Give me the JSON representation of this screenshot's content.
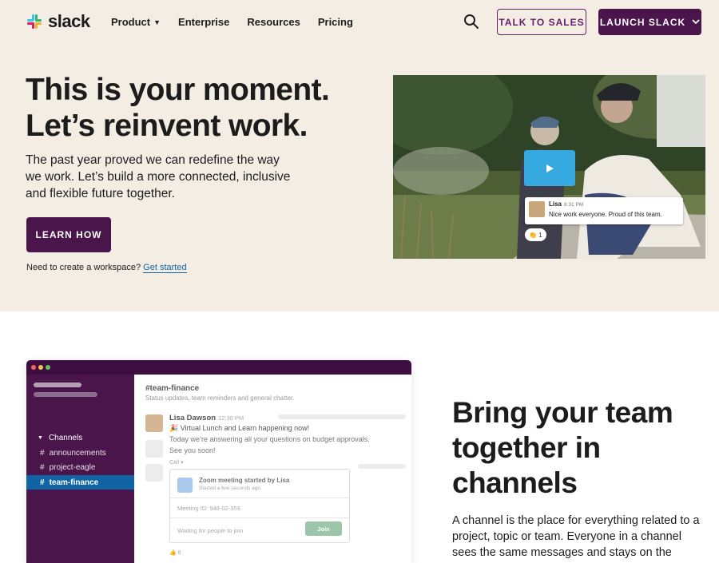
{
  "header": {
    "logo_text": "slack",
    "nav": [
      {
        "label": "Product",
        "has_dropdown": true
      },
      {
        "label": "Enterprise"
      },
      {
        "label": "Resources"
      },
      {
        "label": "Pricing"
      }
    ],
    "search_icon": "search-icon",
    "talk_to_sales": "TALK TO SALES",
    "launch_slack": "LAUNCH SLACK"
  },
  "hero": {
    "headline_1": "This is your moment.",
    "headline_2": "Let’s reinvent work.",
    "body": "The past year proved we can redefine the way we work. Let’s build a more connected, inclusive and flexible future together.",
    "cta": "LEARN HOW",
    "workspace_prompt": "Need to create a workspace?",
    "workspace_link": "Get started",
    "video": {
      "play_icon": "play-icon",
      "message_name": "Lisa",
      "message_time": "8:31 PM",
      "message_text": "Nice work everyone. Proud of this team.",
      "reaction_emoji": "👏",
      "reaction_count": "1"
    }
  },
  "app_preview": {
    "channels_header": "Channels",
    "channels": [
      "announcements",
      "project-eagle",
      "team-finance"
    ],
    "active_channel": "team-finance",
    "channel_title": "#team-finance",
    "channel_topic": "Status updates, team reminders and general chatter.",
    "author": "Lisa Dawson",
    "time": "12:30 PM",
    "line1": "🎉 Virtual Lunch and Learn happening now!",
    "line2": "Today we’re answering all your questions on budget approvals.",
    "line3": "See you soon!",
    "call_label": "Call ▾",
    "zoom_title": "Zoom meeting started by Lisa",
    "zoom_subtitle": "Started a few seconds ago",
    "meeting_id": "Meeting ID: 948-02-359",
    "waiting": "Waiting for people to join",
    "join": "Join",
    "reaction": "👍 8"
  },
  "section2": {
    "headline_1": "Bring your team",
    "headline_2": "together in",
    "headline_3": "channels",
    "body": "A channel is the place for everything related to a project, topic or team. Everyone in a channel sees the same messages and stays on the same page."
  },
  "colors": {
    "aubergine": "#4a154b",
    "purple_border": "#611f69",
    "hero_bg": "#f4ede4",
    "link": "#1264a3",
    "active_channel": "#1164a3",
    "play": "#36a9e1"
  }
}
